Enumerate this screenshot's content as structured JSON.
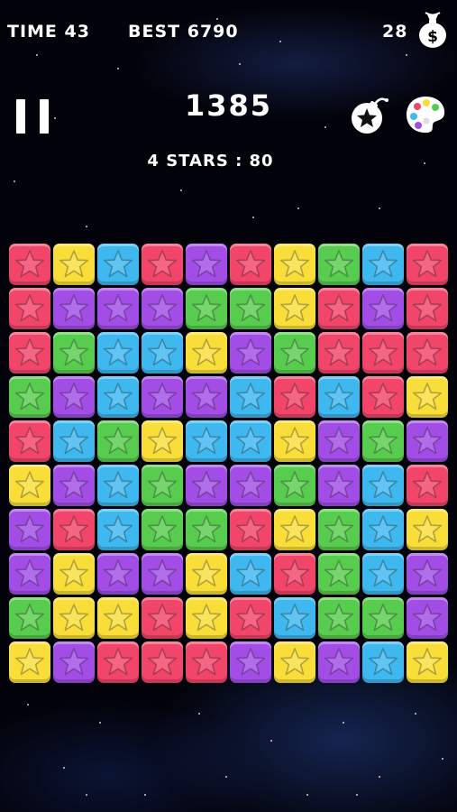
{
  "hud": {
    "time": "TIME 43",
    "best": "BEST 6790",
    "coins": "28",
    "score": "1385",
    "combo": "4 STARS : 80"
  },
  "icons": {
    "pause": "pause-icon",
    "bomb": "bomb-star-icon",
    "palette": "color-palette-icon",
    "money": "money-bag-icon"
  },
  "colors": {
    "red": "#f2456a",
    "yellow": "#f9de3a",
    "blue": "#3fb8ef",
    "purple": "#a24ee6",
    "green": "#58cc4e"
  },
  "board": {
    "rows": [
      [
        "red",
        "yellow",
        "blue",
        "red",
        "purple",
        "red",
        "yellow",
        "green",
        "blue",
        "red"
      ],
      [
        "red",
        "purple",
        "purple",
        "purple",
        "green",
        "green",
        "yellow",
        "red",
        "purple",
        "red"
      ],
      [
        "red",
        "green",
        "blue",
        "blue",
        "yellow",
        "purple",
        "green",
        "red",
        "red",
        "red"
      ],
      [
        "green",
        "purple",
        "blue",
        "purple",
        "purple",
        "blue",
        "red",
        "blue",
        "red",
        "yellow"
      ],
      [
        "red",
        "blue",
        "green",
        "yellow",
        "blue",
        "blue",
        "yellow",
        "purple",
        "green",
        "purple"
      ],
      [
        "yellow",
        "purple",
        "blue",
        "green",
        "purple",
        "purple",
        "green",
        "purple",
        "blue",
        "red"
      ],
      [
        "purple",
        "red",
        "blue",
        "green",
        "green",
        "red",
        "yellow",
        "green",
        "blue",
        "yellow"
      ],
      [
        "purple",
        "yellow",
        "purple",
        "purple",
        "yellow",
        "blue",
        "red",
        "green",
        "blue",
        "purple"
      ],
      [
        "green",
        "yellow",
        "yellow",
        "red",
        "yellow",
        "red",
        "blue",
        "green",
        "green",
        "purple"
      ],
      [
        "yellow",
        "purple",
        "red",
        "red",
        "red",
        "purple",
        "yellow",
        "purple",
        "blue",
        "yellow"
      ]
    ]
  }
}
